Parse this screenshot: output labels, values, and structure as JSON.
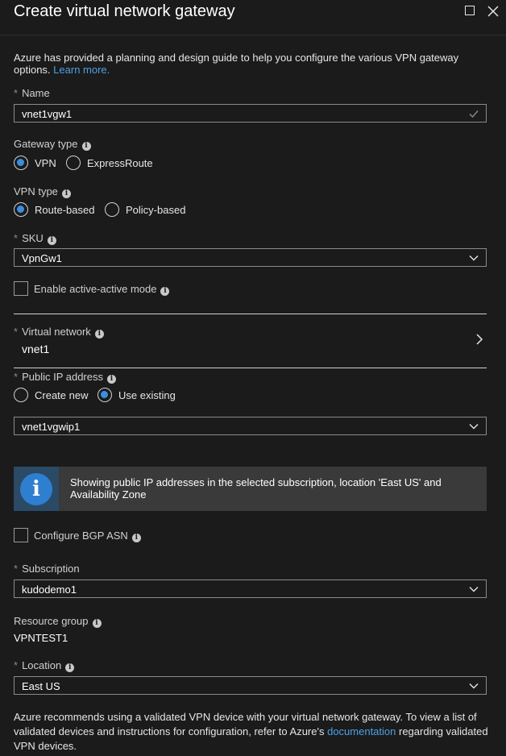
{
  "title": "Create virtual network gateway",
  "intro": {
    "text": "Azure has provided a planning and design guide to help you configure the various VPN gateway options.",
    "link": "Learn more."
  },
  "required_mark": "*",
  "name": {
    "label": "Name",
    "value": "vnet1vgw1"
  },
  "gateway_type": {
    "label": "Gateway type",
    "options": [
      "VPN",
      "ExpressRoute"
    ],
    "selected": "VPN"
  },
  "vpn_type": {
    "label": "VPN type",
    "options": [
      "Route-based",
      "Policy-based"
    ],
    "selected": "Route-based"
  },
  "sku": {
    "label": "SKU",
    "value": "VpnGw1"
  },
  "active_active": {
    "label": "Enable active-active mode",
    "checked": false
  },
  "virtual_network": {
    "label": "Virtual network",
    "value": "vnet1"
  },
  "public_ip": {
    "label": "Public IP address",
    "options": [
      "Create new",
      "Use existing"
    ],
    "selected": "Use existing",
    "value": "vnet1vgwip1"
  },
  "notice": {
    "text": "Showing public IP addresses in the selected subscription,  location 'East US' and Availability Zone"
  },
  "bgp": {
    "label": "Configure BGP ASN",
    "checked": false
  },
  "subscription": {
    "label": "Subscription",
    "value": "kudodemo1"
  },
  "resource_group": {
    "label": "Resource group",
    "value": "VPNTEST1"
  },
  "location": {
    "label": "Location",
    "value": "East US"
  },
  "footer": {
    "text_before": "Azure recommends using a validated VPN device with your virtual network gateway. To view a list of validated devices and instructions for configuration, refer to Azure's",
    "link": "documentation",
    "text_after": "regarding validated VPN devices."
  },
  "colors": {
    "accent": "#3b8de0",
    "link": "#4ea0e6",
    "background": "#1b1b1b",
    "notice_bg": "#3a3a3a"
  }
}
